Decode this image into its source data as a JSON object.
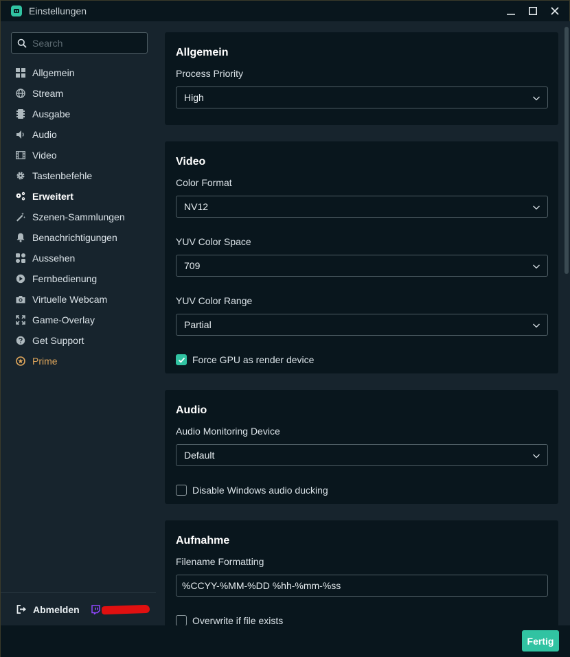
{
  "window": {
    "title": "Einstellungen"
  },
  "search": {
    "placeholder": "Search"
  },
  "sidebar": {
    "items": [
      {
        "label": "Allgemein",
        "icon": "grid-icon"
      },
      {
        "label": "Stream",
        "icon": "globe-icon"
      },
      {
        "label": "Ausgabe",
        "icon": "film-strip-icon"
      },
      {
        "label": "Audio",
        "icon": "speaker-icon"
      },
      {
        "label": "Video",
        "icon": "film-icon"
      },
      {
        "label": "Tastenbefehle",
        "icon": "gear-icon"
      },
      {
        "label": "Erweitert",
        "icon": "gears-icon",
        "active": true
      },
      {
        "label": "Szenen-Sammlungen",
        "icon": "magic-wand-icon"
      },
      {
        "label": "Benachrichtigungen",
        "icon": "bell-icon"
      },
      {
        "label": "Aussehen",
        "icon": "tiles-icon"
      },
      {
        "label": "Fernbedienung",
        "icon": "play-circle-icon"
      },
      {
        "label": "Virtuelle Webcam",
        "icon": "camera-icon"
      },
      {
        "label": "Game-Overlay",
        "icon": "expand-icon"
      },
      {
        "label": "Get Support",
        "icon": "question-icon"
      },
      {
        "label": "Prime",
        "icon": "prime-star-icon"
      }
    ],
    "logout_label": "Abmelden"
  },
  "sections": {
    "general": {
      "title": "Allgemein",
      "process_priority_label": "Process Priority",
      "process_priority_value": "High"
    },
    "video": {
      "title": "Video",
      "color_format_label": "Color Format",
      "color_format_value": "NV12",
      "yuv_space_label": "YUV Color Space",
      "yuv_space_value": "709",
      "yuv_range_label": "YUV Color Range",
      "yuv_range_value": "Partial",
      "force_gpu_label": "Force GPU as render device",
      "force_gpu_checked": true
    },
    "audio": {
      "title": "Audio",
      "monitoring_label": "Audio Monitoring Device",
      "monitoring_value": "Default",
      "ducking_label": "Disable Windows audio ducking",
      "ducking_checked": false
    },
    "recording": {
      "title": "Aufnahme",
      "filename_label": "Filename Formatting",
      "filename_value": "%CCYY-%MM-%DD %hh-%mm-%ss",
      "overwrite_label": "Overwrite if file exists",
      "overwrite_checked": false
    }
  },
  "footer": {
    "done_label": "Fertig"
  },
  "colors": {
    "accent": "#31c3a2",
    "prime": "#e0a75c",
    "panel": "#09161d",
    "background": "#17242d"
  }
}
